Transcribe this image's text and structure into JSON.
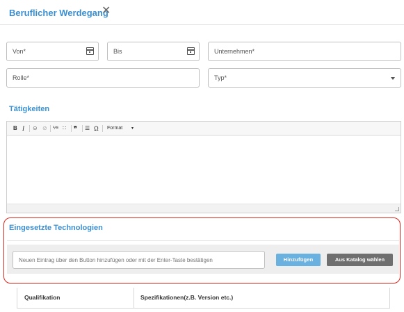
{
  "dialog": {
    "title": "Beruflicher Werdegang",
    "close_symbol": "✕"
  },
  "form": {
    "von": "Von*",
    "bis": "Bis",
    "unternehmen": "Unternehmen*",
    "rolle": "Rolle*",
    "typ": "Typ*"
  },
  "taetigkeiten": {
    "title": "Tätigkeiten",
    "toolbar": {
      "bold": "B",
      "italic": "I",
      "link": "⊝",
      "unlink": "⊘",
      "numbered_list": "⅟≡",
      "bulleted_list": "∷",
      "blockquote": "❞",
      "horizontal_rule": "☰",
      "special_char": "Ω",
      "format": "Format",
      "format_caret": "▾"
    }
  },
  "technologien": {
    "title": "Eingesetzte Technologien",
    "input_placeholder": "Neuen Eintrag über den Button hinzufügen oder mit der Enter-Taste bestätigen",
    "add_button": "Hinzufügen",
    "catalog_button": "Aus Katalog wählen"
  },
  "table": {
    "columns": [
      "Qualifikation",
      "Spezifikationen(z.B. Version etc.)"
    ]
  },
  "colors": {
    "accent": "#3b8fd0",
    "highlight": "#d9271e",
    "add_button": "#6ab1df",
    "catalog_button": "#6f6f6f"
  }
}
